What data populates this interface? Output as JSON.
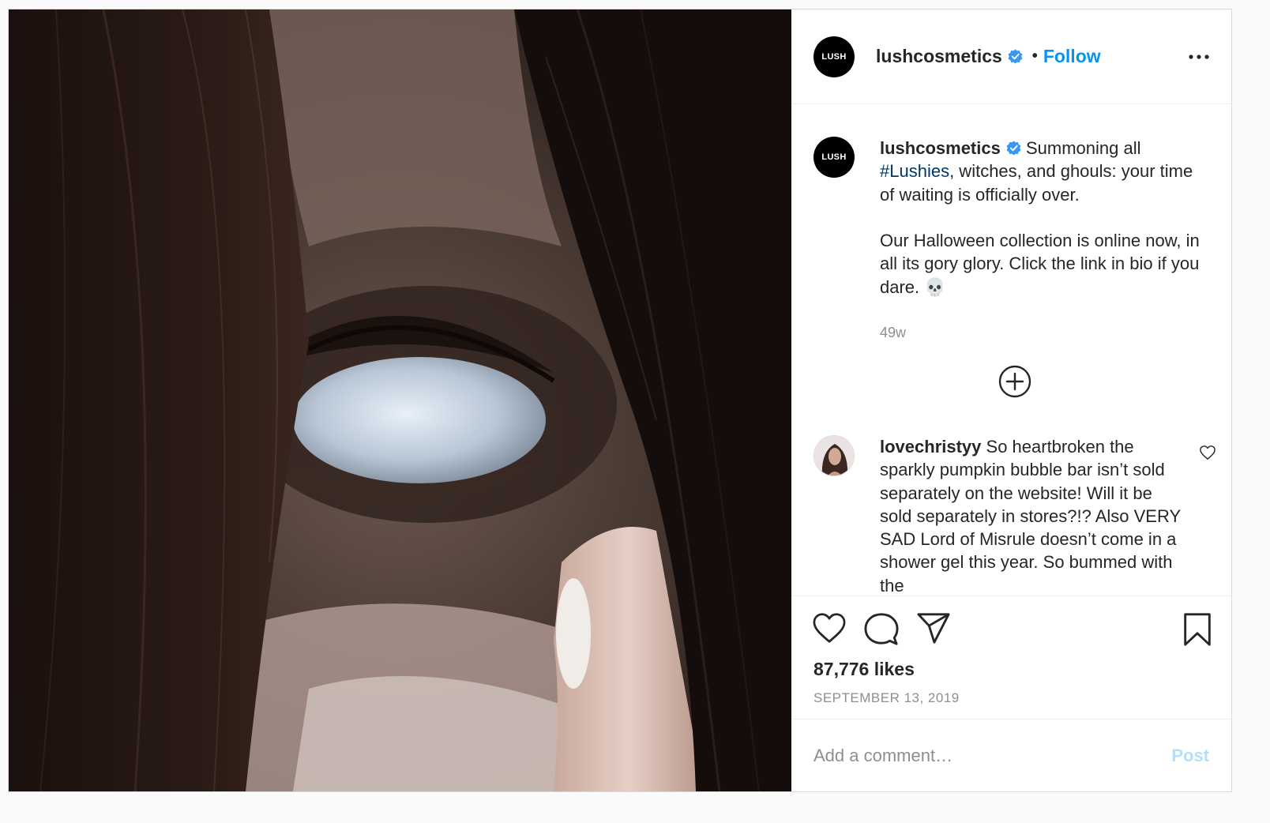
{
  "post_author": {
    "avatar_text": "LUSH",
    "username": "lushcosmetics",
    "verified_icon": "verified-badge-icon",
    "separator": "•",
    "follow_label": "Follow",
    "more_icon": "more-options-icon"
  },
  "caption": {
    "username": "lushcosmetics",
    "text_part1": " Summoning all ",
    "hashtag": "#Lushies",
    "text_part2": ", witches, and ghouls: your time of waiting is officially over.\n\nOur Halloween collection is online now, in all its gory glory. Click the link in bio if you dare. 💀",
    "time_ago": "49w"
  },
  "load_more_icon": "plus-circle-icon",
  "comments": [
    {
      "username": "lovechristyy",
      "text": " So heartbroken the sparkly pumpkin bubble bar isn’t sold separately on the website! Will it be sold separately in stores?!? Also VERY SAD Lord of Misrule doesn’t come in a shower gel this year. So bummed with the",
      "like_icon": "heart-outline-icon"
    }
  ],
  "actions": {
    "like_icon": "heart-icon",
    "comment_icon": "comment-icon",
    "share_icon": "share-icon",
    "save_icon": "bookmark-icon"
  },
  "likes_text": "87,776 likes",
  "date_text": "SEPTEMBER 13, 2019",
  "add_comment": {
    "placeholder": "Add a comment…",
    "post_label": "Post"
  },
  "colors": {
    "accent": "#0095f6",
    "hashtag": "#00376b",
    "muted": "#8e8e8e",
    "post_disabled": "#b2dffc"
  }
}
